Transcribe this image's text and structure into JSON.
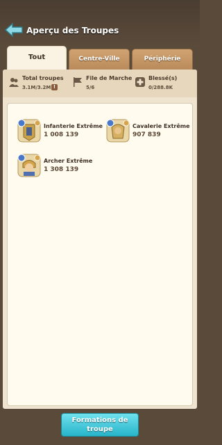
{
  "header": {
    "title": "Aperçu des Troupes"
  },
  "tabs": [
    {
      "label": "Tout",
      "active": true
    },
    {
      "label": "Centre-Ville",
      "active": false
    },
    {
      "label": "Périphérie",
      "active": false
    }
  ],
  "stats": {
    "total": {
      "label": "Total troupes",
      "value": "3.1M/3.2M",
      "icon": "troops-icon"
    },
    "march": {
      "label": "File de Marche",
      "value": "5/6",
      "icon": "flag-icon"
    },
    "wounded": {
      "label": "Blessé(s)",
      "value": "0/288.8K",
      "icon": "medic-icon"
    }
  },
  "troops": [
    {
      "name": "Infanterie Extrême",
      "count": "1 008 139",
      "type": "infantry"
    },
    {
      "name": "Cavalerie Extrême",
      "count": "907 839",
      "type": "cavalry"
    },
    {
      "name": "Archer Extrême",
      "count": "1 308 139",
      "type": "archer"
    }
  ],
  "footer": {
    "button_line1": "Formations de",
    "button_line2": "troupe"
  },
  "colors": {
    "accent": "#27b4c9",
    "panel": "#fffbee",
    "tab": "#c99a68"
  }
}
